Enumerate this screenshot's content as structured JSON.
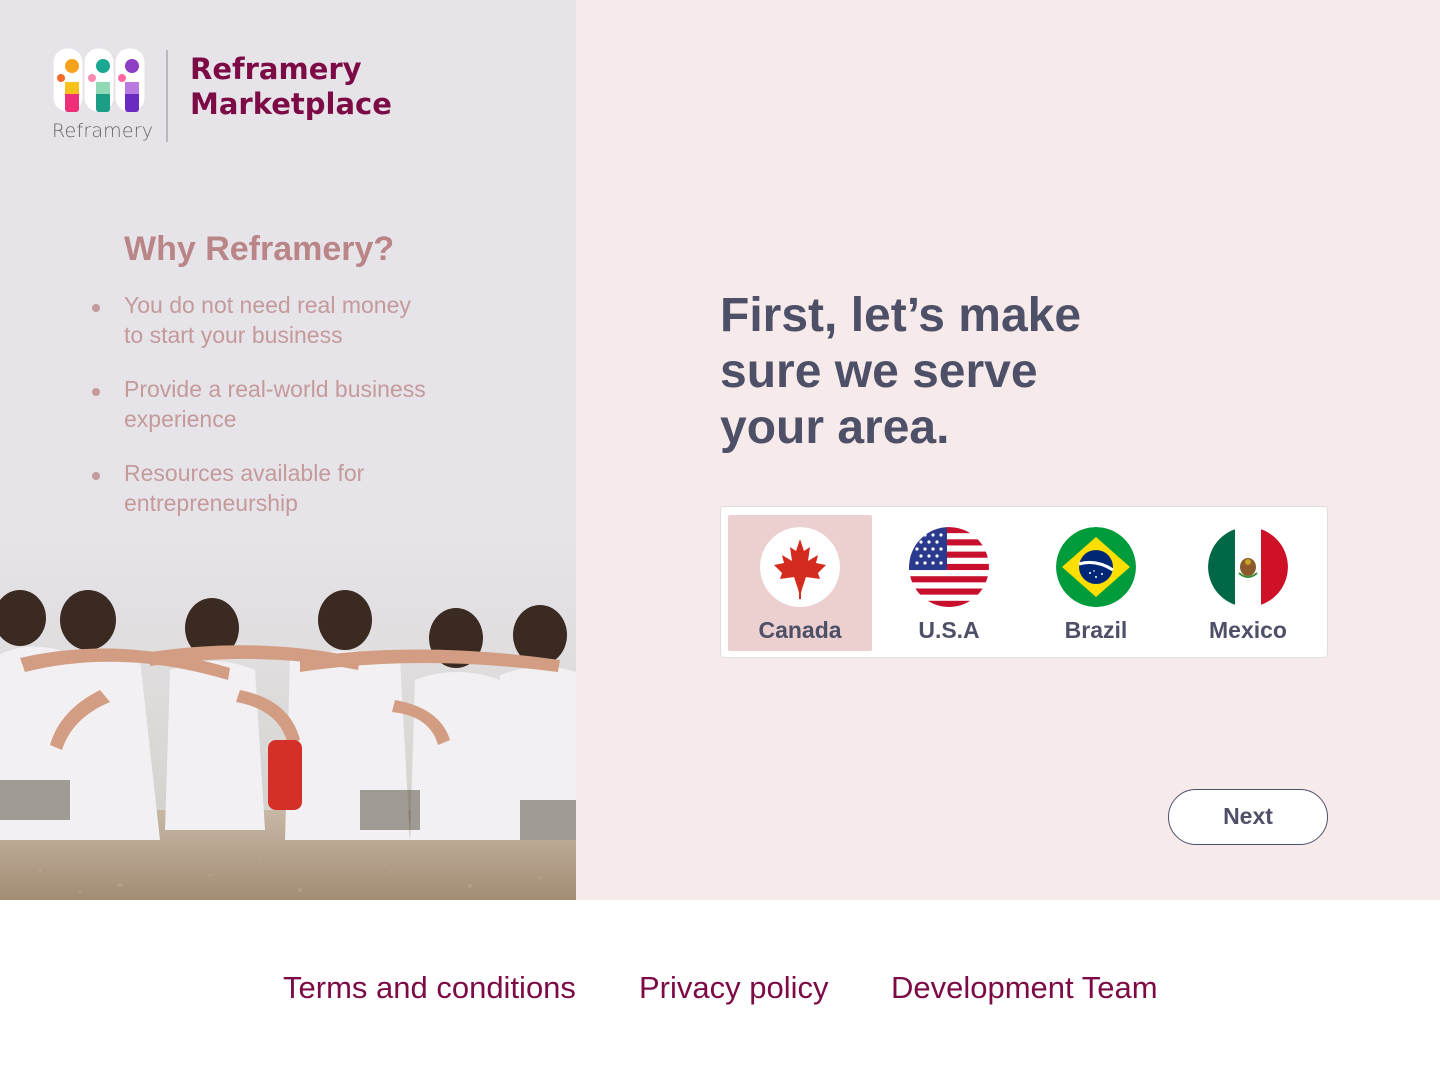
{
  "brand": {
    "logo_word": "Reframery",
    "name_line1": "Reframery",
    "name_line2": "Marketplace",
    "logo_icon": "reframery-logo"
  },
  "why": {
    "title": "Why Reframery?",
    "items": [
      {
        "line1": "You do not need real money",
        "line2": "to start your business"
      },
      {
        "line1": "Provide a real-world business",
        "line2": "experience"
      },
      {
        "line1": "Resources available for",
        "line2": "entrepreneurship"
      }
    ]
  },
  "main": {
    "headline_line1": "First, let’s make",
    "headline_line2": "sure we serve",
    "headline_line3": "your area.",
    "countries": [
      {
        "label": "Canada",
        "icon": "canada-flag-icon",
        "selected": true
      },
      {
        "label": "U.S.A",
        "icon": "usa-flag-icon",
        "selected": false
      },
      {
        "label": "Brazil",
        "icon": "brazil-flag-icon",
        "selected": false
      },
      {
        "label": "Mexico",
        "icon": "mexico-flag-icon",
        "selected": false
      }
    ],
    "next_label": "Next"
  },
  "footer": {
    "terms": "Terms and conditions",
    "privacy": "Privacy policy",
    "team": "Development Team"
  },
  "colors": {
    "brand": "#7b0a45",
    "headline": "#4e5068",
    "left_bg": "#e6e3e9",
    "right_bg": "#f6eaea",
    "selected_bg": "#eccfcf",
    "why_text": "#c49a9b"
  }
}
